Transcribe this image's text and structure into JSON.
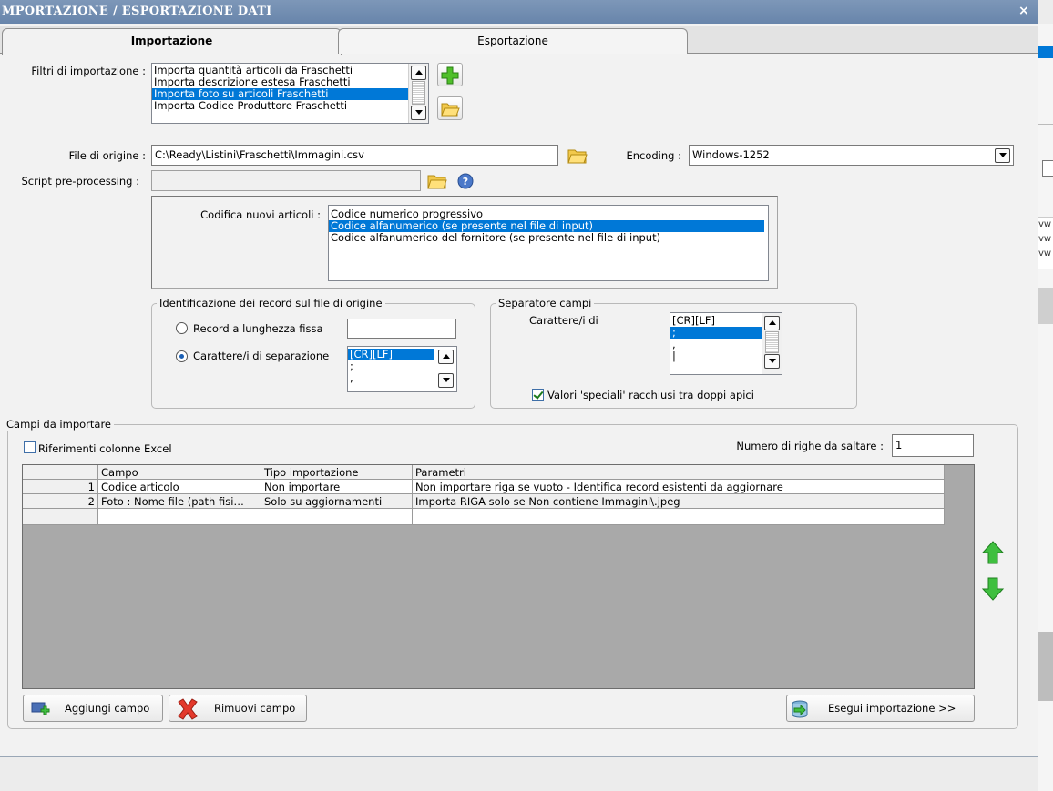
{
  "window": {
    "title": "MPORTAZIONE / ESPORTAZIONE DATI",
    "close": "×"
  },
  "tabs": [
    {
      "label": "Importazione",
      "active": true
    },
    {
      "label": "Esportazione",
      "active": false
    }
  ],
  "filters": {
    "label": "Filtri di importazione :",
    "items": [
      "Importa quantità articoli da Fraschetti",
      "Importa descrizione estesa Fraschetti",
      "Importa foto su articoli Fraschetti",
      "Importa Codice Produttore Fraschetti"
    ],
    "selected_index": 2
  },
  "source_file": {
    "label": "File di origine :",
    "value": "C:\\Ready\\Listini\\Fraschetti\\Immagini.csv"
  },
  "encoding": {
    "label": "Encoding :",
    "value": "Windows-1252"
  },
  "script": {
    "label": "Script pre-processing :",
    "value": ""
  },
  "coding": {
    "label": "Codifica nuovi articoli :",
    "items": [
      "Codice numerico progressivo",
      "Codice alfanumerico (se presente nel file di input)",
      "Codice alfanumerico del fornitore (se presente nel file di input)"
    ],
    "selected_index": 1
  },
  "record_id": {
    "legend": "Identificazione dei record sul file di origine",
    "fixed_label": "Record a lunghezza fissa",
    "fixed_value": "",
    "sep_label": "Carattere/i di separazione",
    "selected": "separator",
    "sep_items": [
      "[CR][LF]",
      ";",
      ","
    ],
    "sep_selected_index": 0
  },
  "field_sep": {
    "legend": "Separatore campi",
    "label": "Carattere/i di",
    "items": [
      "[CR][LF]",
      ";",
      ",",
      "|"
    ],
    "selected_index": 1,
    "quotes_label": "Valori 'speciali' racchiusi tra doppi apici",
    "quotes_checked": true
  },
  "fields": {
    "legend": "Campi da importare",
    "excel_label": "Riferimenti colonne Excel",
    "excel_checked": false,
    "skip_label": "Numero di righe da saltare :",
    "skip_value": "1",
    "columns": [
      "Campo",
      "Tipo importazione",
      "Parametri"
    ],
    "rows": [
      {
        "num": "1",
        "campo": "Codice articolo",
        "tipo": "Non importare",
        "parametri": "Non importare riga se vuoto - Identifica record esistenti da aggiornare"
      },
      {
        "num": "2",
        "campo": "Foto : Nome file (path fisi…",
        "tipo": "Solo su aggiornamenti",
        "parametri": "Importa RIGA solo se Non contiene Immagini\\.jpeg"
      }
    ]
  },
  "buttons": {
    "add_field": "Aggiungi campo",
    "remove_field": "Rimuovi campo",
    "run_import": "Esegui importazione >>"
  },
  "colors": {
    "title_bar": "#6f8bb0",
    "selection": "#0078d7",
    "grid_bg": "#a9a9a9"
  }
}
